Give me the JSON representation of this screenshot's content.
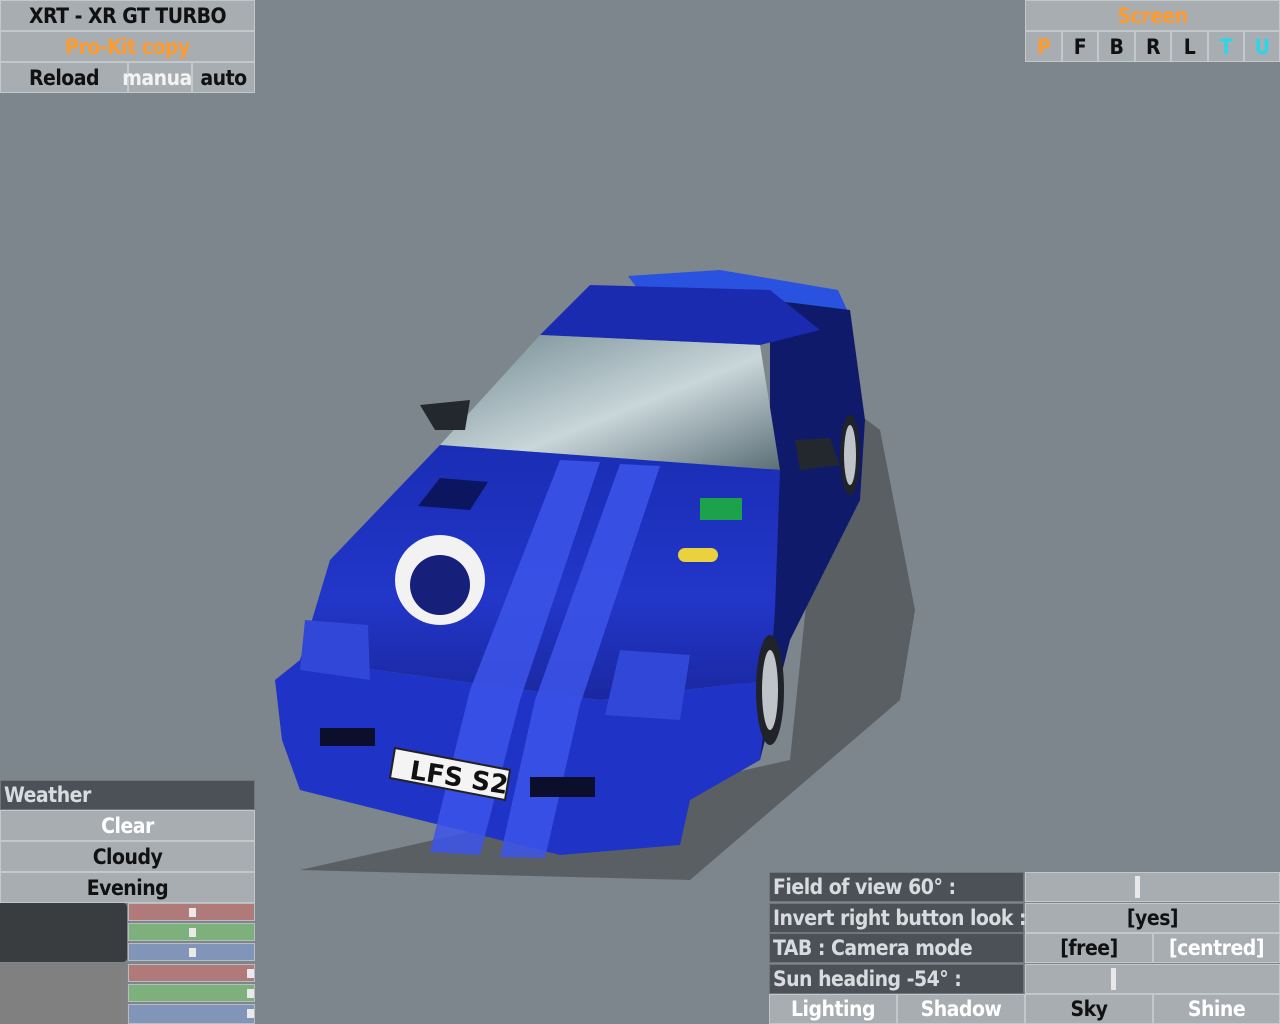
{
  "top_left": {
    "car_title": "XRT - XR GT TURBO",
    "skin_name": "Pro-Kit copy",
    "reload": "Reload",
    "manual": "manual",
    "auto": "auto"
  },
  "screen_panel": {
    "title": "Screen",
    "buttons": [
      "P",
      "F",
      "B",
      "R",
      "L",
      "T",
      "U"
    ]
  },
  "car": {
    "plate": "LFS S2",
    "colors": {
      "body": "#1f2fb8",
      "stripe": "#3a4fe0",
      "accent": "#ff9a2e"
    }
  },
  "weather": {
    "header": "Weather",
    "options": [
      "Clear",
      "Cloudy",
      "Evening"
    ]
  },
  "color_sliders": {
    "top_group": [
      {
        "channel": "red",
        "color": "#b07a7a",
        "level": 0.5
      },
      {
        "channel": "green",
        "color": "#7db07a",
        "level": 0.5
      },
      {
        "channel": "blue",
        "color": "#8095b8",
        "level": 0.5
      }
    ],
    "bottom_group": [
      {
        "channel": "red",
        "color": "#b07a7a",
        "level": 0.96
      },
      {
        "channel": "green",
        "color": "#7db07a",
        "level": 0.96
      },
      {
        "channel": "blue",
        "color": "#8095b8",
        "level": 0.96
      }
    ],
    "swatch_top": "#3a3d40",
    "swatch_bottom": "#808080"
  },
  "view_panel": {
    "fov_label": "Field of view 60° :",
    "fov_level": 0.43,
    "invert_label": "Invert right button look :",
    "invert_value": "[yes]",
    "camera_label": "TAB : Camera mode",
    "camera_free": "[free]",
    "camera_centred": "[centred]",
    "sun_label": "Sun heading -54° :",
    "sun_level": 0.34,
    "tabs": [
      "Lighting",
      "Shadow",
      "Sky",
      "Shine"
    ]
  }
}
